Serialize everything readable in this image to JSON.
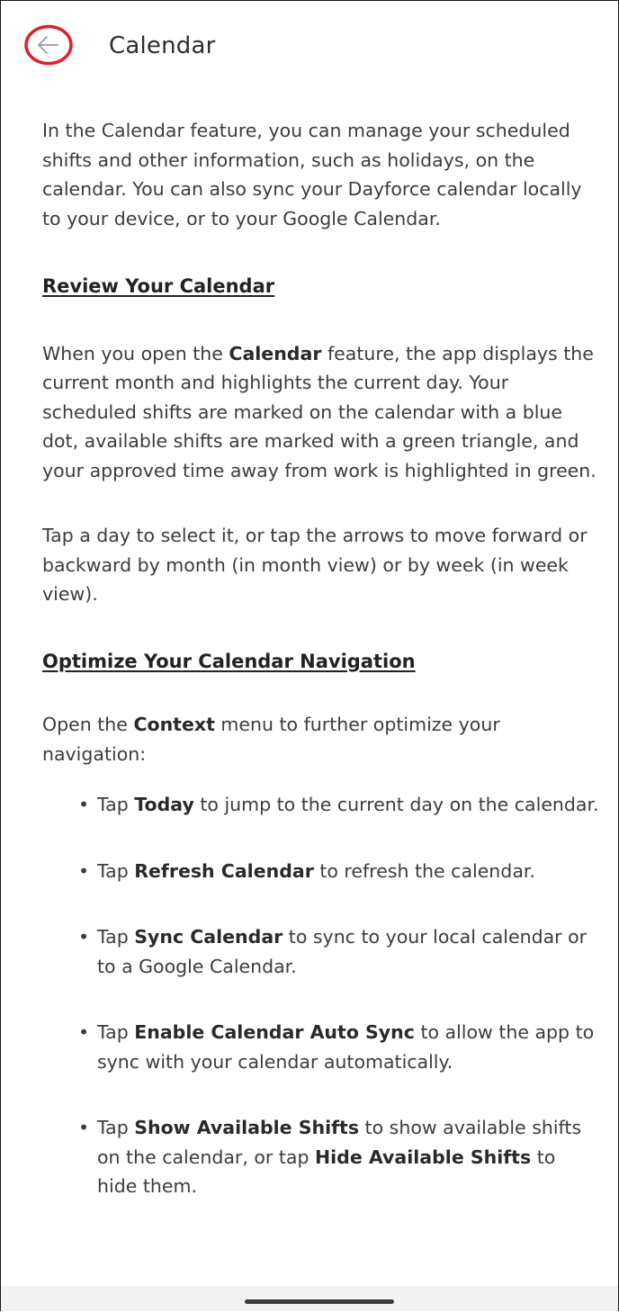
{
  "header": {
    "back_icon": "arrow-left-icon",
    "title": "Calendar",
    "highlight_color": "#e02027"
  },
  "intro": "In the Calendar feature, you can manage your scheduled shifts and other information, such as holidays, on the calendar. You can also sync your Dayforce calendar locally to your device, or to your Google Calendar.",
  "sections": {
    "review": {
      "heading": "Review Your Calendar",
      "p1_before": "When you open the ",
      "p1_bold": "Calendar",
      "p1_after": " feature, the app displays the current month and highlights the current day. Your scheduled shifts are marked on the calendar with a blue dot, available shifts are marked with a green triangle, and your approved time away from work is highlighted in green.",
      "p2": "Tap a day to select it, or tap the arrows to move forward or backward by month (in month view) or by week (in week view)."
    },
    "optimize": {
      "heading": "Optimize Your Calendar Navigation",
      "p_before": "Open the ",
      "p_bold": "Context",
      "p_after": " menu to further optimize your navigation:",
      "bullets": [
        {
          "pre": "Tap ",
          "bold": "Today",
          "post": " to jump to the current day on the calendar."
        },
        {
          "pre": "Tap ",
          "bold": "Refresh Calendar",
          "post": " to refresh the calendar."
        },
        {
          "pre": "Tap ",
          "bold": "Sync Calendar",
          "post": " to sync to your local calendar or to a Google Calendar."
        },
        {
          "pre": "Tap ",
          "bold": "Enable Calendar Auto Sync",
          "post": " to allow the app to sync with your calendar automatically."
        },
        {
          "pre": "Tap ",
          "bold": "Show Available Shifts",
          "post": " to show available shifts on the calendar, or tap ",
          "bold2": "Hide Available Shifts",
          "post2": " to hide them."
        }
      ]
    }
  },
  "bullet_glyph": "•"
}
